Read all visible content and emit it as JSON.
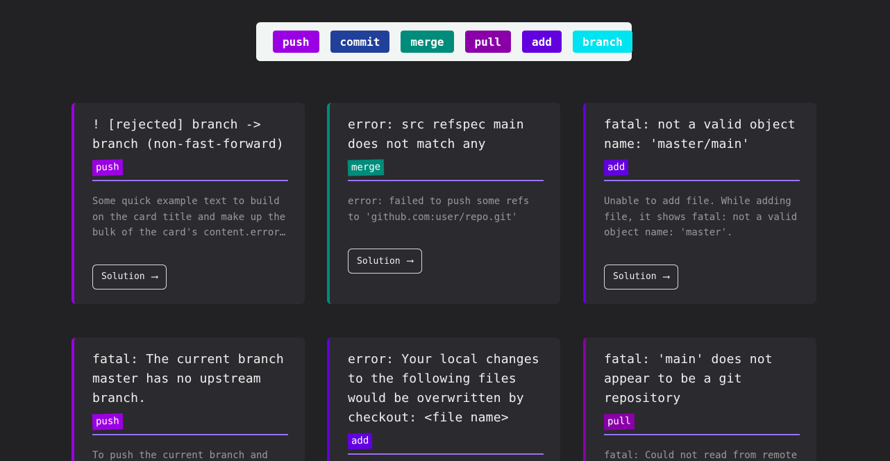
{
  "filters": [
    {
      "label": "push",
      "color": "#9b00e3"
    },
    {
      "label": "commit",
      "color": "#21409a"
    },
    {
      "label": "merge",
      "color": "#008c7a"
    },
    {
      "label": "pull",
      "color": "#8a00a8"
    },
    {
      "label": "add",
      "color": "#6200e0"
    },
    {
      "label": "branch",
      "color": "#00e3f0"
    }
  ],
  "solution_label": "Solution",
  "cards": [
    {
      "title": "! [rejected] branch -> branch (non-fast-forward)",
      "tag": "push",
      "tag_color": "#9b00e3",
      "accent": "#9b00e3",
      "desc": "Some quick example text to build on the card title and make up the bulk of the card's content.error: failed to push some refs"
    },
    {
      "title": "error: src refspec main does not match any",
      "tag": "merge",
      "tag_color": "#008c7a",
      "accent": "#008c7a",
      "desc": "error: failed to push some refs to 'github.com:user/repo.git'"
    },
    {
      "title": "fatal: not a valid object name: 'master/main'",
      "tag": "add",
      "tag_color": "#6200e0",
      "accent": "#6200e0",
      "desc": "Unable to add file. While adding file, it shows fatal: not a valid object name: 'master'."
    },
    {
      "title": "fatal: The current branch master has no upstream branch.",
      "tag": "push",
      "tag_color": "#9b00e3",
      "accent": "#9b00e3",
      "desc": "To push the current branch and"
    },
    {
      "title": "error: Your local changes to the following files would be overwritten by checkout: <file name>",
      "tag": "add",
      "tag_color": "#6200e0",
      "accent": "#6200e0",
      "desc": ""
    },
    {
      "title": "fatal: 'main' does not appear to be a git repository",
      "tag": "pull",
      "tag_color": "#8a00a8",
      "accent": "#8a00a8",
      "desc": "fatal: Could not read from remote"
    }
  ]
}
